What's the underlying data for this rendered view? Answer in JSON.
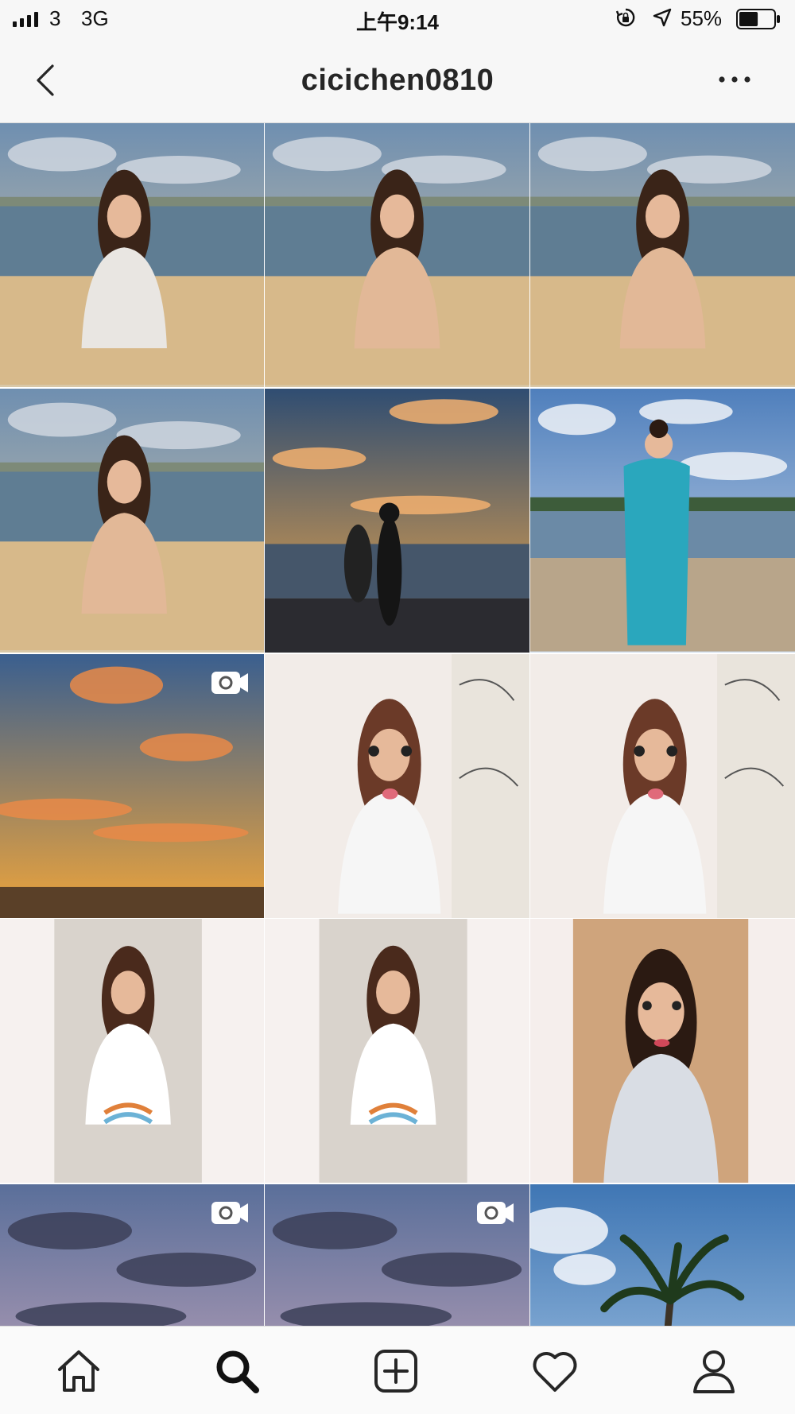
{
  "status_bar": {
    "carrier": "3",
    "network": "3G",
    "time": "上午9:14",
    "battery_percent": "55%",
    "battery_level": 0.55
  },
  "header": {
    "title": "cicichen0810"
  },
  "icons": {
    "back": "chevron-left-icon",
    "more": "more-horizontal-icon",
    "video": "video-camera-icon",
    "home": "home-icon",
    "search": "search-icon",
    "new_post": "plus-square-icon",
    "activity": "heart-icon",
    "profile": "person-icon"
  },
  "grid": {
    "columns": 3,
    "posts": [
      {
        "kind": "photo",
        "subject": "beach-portrait"
      },
      {
        "kind": "photo",
        "subject": "beach-portrait"
      },
      {
        "kind": "photo",
        "subject": "beach-portrait"
      },
      {
        "kind": "photo",
        "subject": "beach-portrait"
      },
      {
        "kind": "photo",
        "subject": "sunset-silhouette"
      },
      {
        "kind": "photo",
        "subject": "beach-towel"
      },
      {
        "kind": "video",
        "subject": "sunset-sky"
      },
      {
        "kind": "photo",
        "subject": "selfie-filter"
      },
      {
        "kind": "photo",
        "subject": "selfie-filter"
      },
      {
        "kind": "photo",
        "subject": "selfie-mall"
      },
      {
        "kind": "photo",
        "subject": "selfie-mall"
      },
      {
        "kind": "photo",
        "subject": "selfie-closeup"
      },
      {
        "kind": "video",
        "subject": "cloudy-sky"
      },
      {
        "kind": "video",
        "subject": "cloudy-sky"
      },
      {
        "kind": "photo",
        "subject": "palm-tree-sky"
      }
    ]
  },
  "colors": {
    "accent": "#262626",
    "divider": "#dbdbdb",
    "bar_background": "#f7f7f7"
  }
}
